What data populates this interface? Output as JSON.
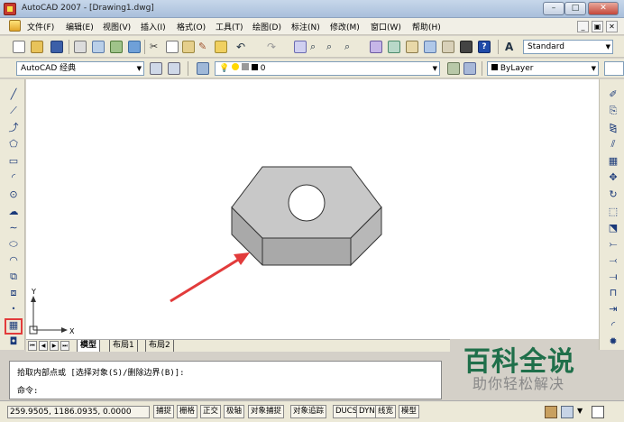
{
  "window": {
    "title": "AutoCAD 2007 - [Drawing1.dwg]",
    "controls": {
      "minimize": "–",
      "maximize": "□",
      "close": "✕"
    },
    "doc_controls": {
      "minimize": "_",
      "restore": "▣",
      "close": "✕"
    }
  },
  "menu": [
    "文件(F)",
    "编辑(E)",
    "视图(V)",
    "插入(I)",
    "格式(O)",
    "工具(T)",
    "绘图(D)",
    "标注(N)",
    "修改(M)",
    "窗口(W)",
    "帮助(H)"
  ],
  "toolbar": {
    "text_style": "Standard",
    "workspace": "AutoCAD 经典",
    "layer": "0",
    "color": "ByLayer",
    "linetype": "ByLayer"
  },
  "layout_tabs": [
    "模型",
    "布局1",
    "布局2"
  ],
  "ucs": {
    "x_label": "X",
    "y_label": "Y"
  },
  "command": {
    "line1": "拾取内部点或 [选择对象(S)/删除边界(B)]:",
    "line2": "命令:"
  },
  "status": {
    "coords": "259.9505, 1186.0935, 0.0000",
    "buttons": [
      "捕捉",
      "栅格",
      "正交",
      "极轴",
      "对象捕捉",
      "对象追踪",
      "DUCS",
      "DYN",
      "线宽",
      "模型"
    ]
  },
  "watermark": {
    "title": "百科全说",
    "subtitle": "助你轻松解决"
  },
  "colors": {
    "arrow": "#e23b3b",
    "shape_top": "#c8c8c8",
    "shape_side": "#a9a9a9",
    "watermark": "#1f6f4a"
  },
  "icons": {
    "left_toolbar": [
      "line-icon",
      "construction-line-icon",
      "polyline-icon",
      "polygon-icon",
      "rectangle-icon",
      "arc-icon",
      "circle-icon",
      "revision-cloud-icon",
      "spline-icon",
      "ellipse-icon",
      "ellipse-arc-icon",
      "insert-block-icon",
      "make-block-icon",
      "point-icon",
      "hatch-icon",
      "region-icon"
    ],
    "right_toolbar": [
      "erase-icon",
      "copy-icon",
      "mirror-icon",
      "offset-icon",
      "array-icon",
      "move-icon",
      "rotate-icon",
      "scale-icon",
      "stretch-icon",
      "trim-icon",
      "extend-icon",
      "break-icon",
      "join-icon",
      "chamfer-icon",
      "fillet-icon",
      "explode-icon"
    ]
  }
}
